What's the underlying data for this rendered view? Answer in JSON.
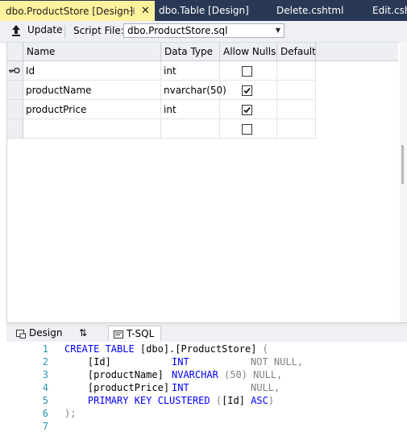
{
  "tabs": [
    {
      "label": "dbo.ProductStore [Design]",
      "pin": "⊣",
      "close": "✕"
    },
    {
      "label": "dbo.Table [Design]"
    },
    {
      "label": "Delete.cshtml"
    },
    {
      "label": "Edit.csht"
    }
  ],
  "toolbar": {
    "update_label": "Update",
    "script_file_label": "Script File:",
    "script_file_value": "dbo.ProductStore.sql"
  },
  "grid": {
    "columns": [
      "Name",
      "Data Type",
      "Allow Nulls",
      "Default"
    ],
    "rows": [
      {
        "name": "Id",
        "type": "int",
        "allow_nulls": false,
        "primary_key": true
      },
      {
        "name": "productName",
        "type": "nvarchar(50)",
        "allow_nulls": true,
        "primary_key": false
      },
      {
        "name": "productPrice",
        "type": "int",
        "allow_nulls": true,
        "primary_key": false
      },
      {
        "name": "",
        "type": "",
        "allow_nulls": false,
        "primary_key": false
      }
    ]
  },
  "bottom_tabs": {
    "design": "Design",
    "swap": "⇅",
    "tsql": "T-SQL"
  },
  "sql": {
    "line_numbers": [
      "1",
      "2",
      "3",
      "4",
      "5",
      "6",
      "7"
    ],
    "l1_kw": "CREATE TABLE",
    "l1_rest": " [dbo].[ProductStore]",
    "l1_paren": " (",
    "l2_col": "    [Id]",
    "l2_type": "INT",
    "l2_null": "NOT NULL,",
    "l3_col": "    [productName]",
    "l3_type": "NVARCHAR",
    "l3_size": " (50)",
    "l3_null": " NULL,",
    "l4_col": "    [productPrice]",
    "l4_type": "INT",
    "l4_null": "NULL,",
    "l5_kw": "    PRIMARY KEY CLUSTERED",
    "l5_open": " (",
    "l5_col": "[Id]",
    "l5_asc": " ASC",
    "l5_close": ")",
    "l6": ");"
  },
  "colors": {
    "tab_strip": "#293955",
    "active_tab": "#fff29d",
    "keyword": "#0000ff",
    "line_number": "#2b91af",
    "punctuation": "#808080"
  }
}
